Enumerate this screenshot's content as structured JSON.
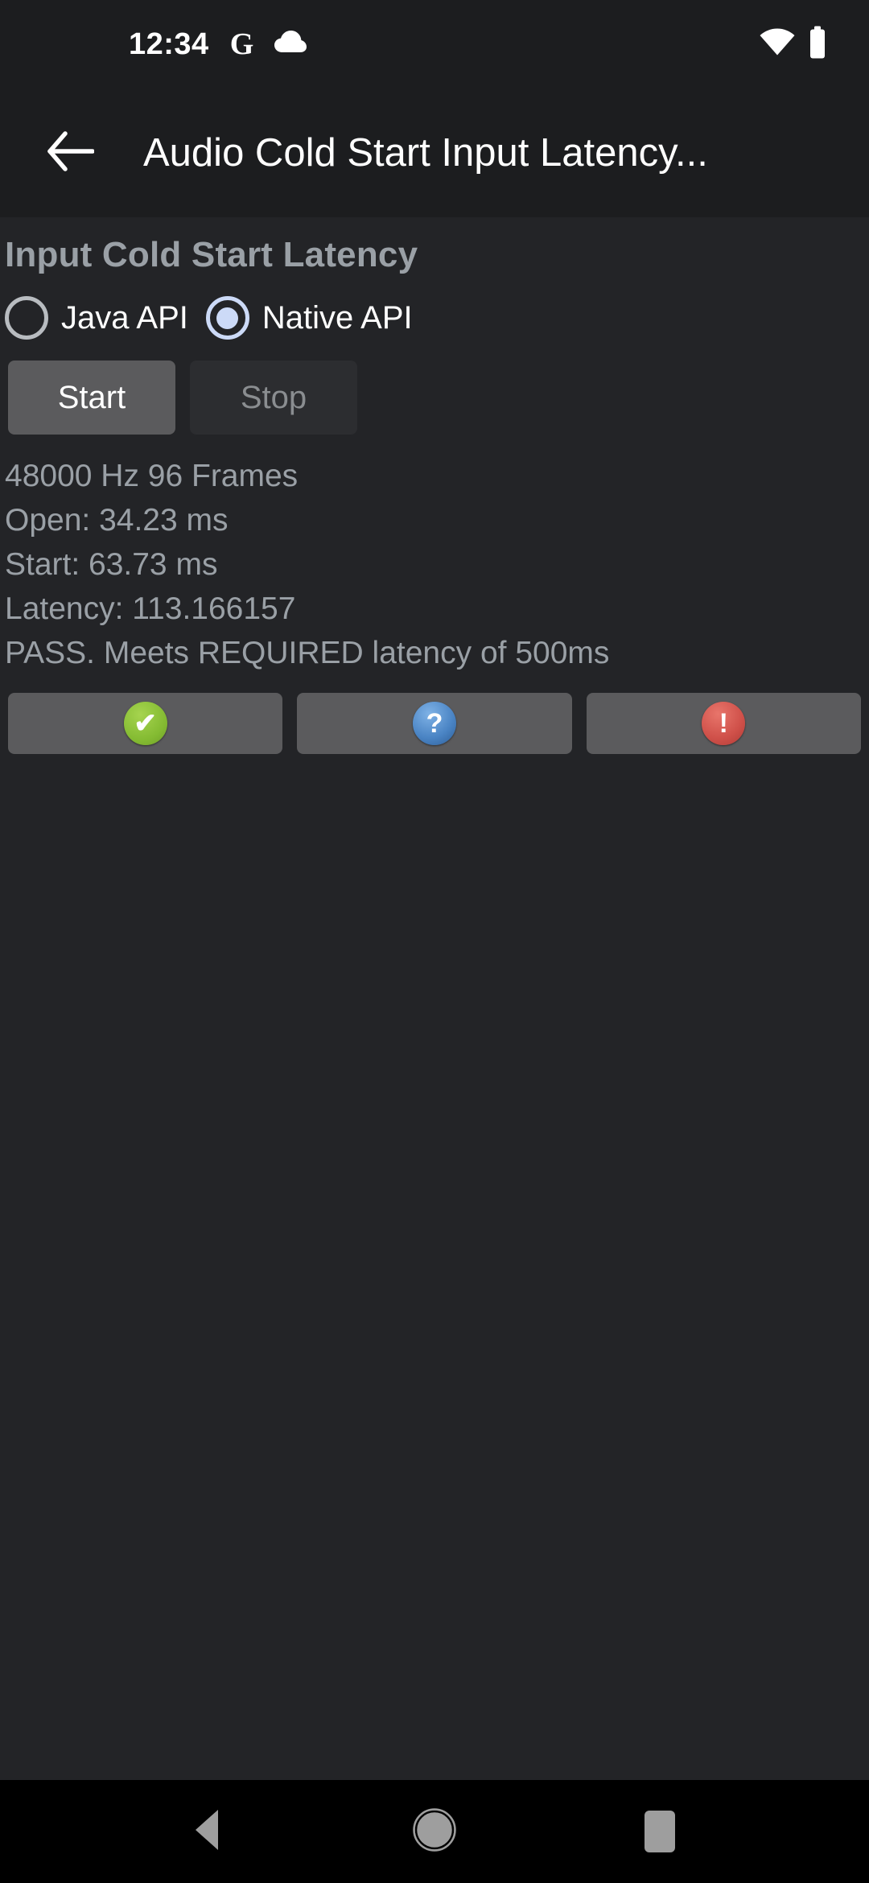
{
  "status_bar": {
    "clock": "12:34",
    "google_icon": "G",
    "icons": [
      "google-icon",
      "cloud-icon",
      "wifi-icon",
      "battery-icon"
    ]
  },
  "app_bar": {
    "back_icon": "back-arrow-icon",
    "title": "Audio Cold Start Input Latency..."
  },
  "main": {
    "section_title": "Input Cold Start Latency",
    "api_options": [
      {
        "label": "Java API",
        "selected": false
      },
      {
        "label": "Native API",
        "selected": true
      }
    ],
    "buttons": {
      "start_label": "Start",
      "start_enabled": true,
      "stop_label": "Stop",
      "stop_enabled": false
    },
    "results": [
      "48000 Hz 96 Frames",
      "Open: 34.23 ms",
      "Start: 63.73 ms",
      "Latency: 113.166157",
      "PASS. Meets REQUIRED latency of 500ms"
    ],
    "verdict_buttons": [
      {
        "name": "pass-button",
        "glyph": "✔",
        "color": "#84bb32"
      },
      {
        "name": "info-button",
        "glyph": "?",
        "color": "#4a84c4"
      },
      {
        "name": "fail-button",
        "glyph": "!",
        "color": "#d0514a"
      }
    ]
  },
  "nav_bar": {
    "back_label": "back-triangle-icon",
    "home_label": "home-circle-icon",
    "recents_label": "recents-square-icon"
  }
}
